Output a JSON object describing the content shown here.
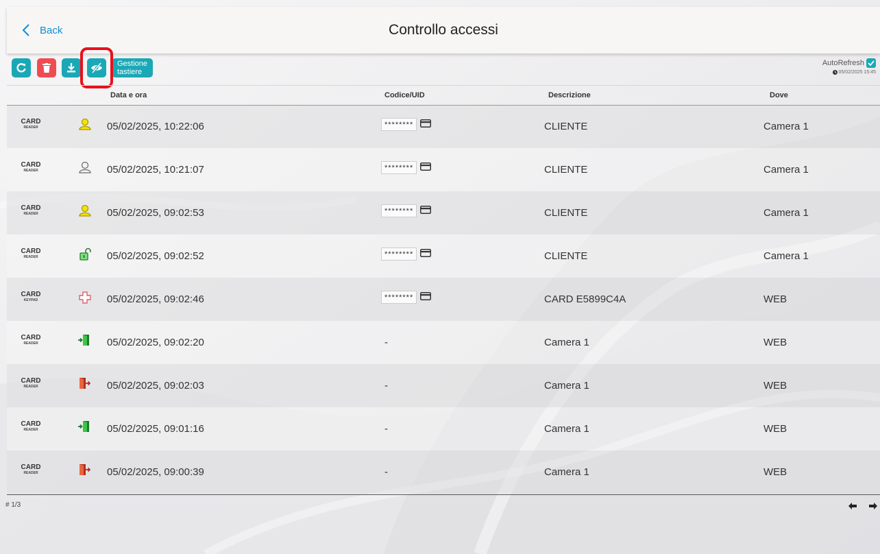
{
  "header": {
    "back_label": "Back",
    "title": "Controllo accessi"
  },
  "toolbar": {
    "buttons": [
      {
        "name": "refresh",
        "icon": "refresh-icon"
      },
      {
        "name": "delete",
        "icon": "trash-icon"
      },
      {
        "name": "download",
        "icon": "download-icon"
      },
      {
        "name": "hide",
        "icon": "eye-slash-icon",
        "highlighted": true
      }
    ],
    "gestione_label": "Gestione tastiere"
  },
  "autorefresh": {
    "label": "AutoRefresh",
    "checked": true,
    "timestamp": "05/02/2025 15:45"
  },
  "table": {
    "columns": {
      "date": "Data e ora",
      "code": "Codice/UID",
      "desc": "Descrizione",
      "dove": "Dove"
    },
    "rows": [
      {
        "src_a": "CARD",
        "src_b": "READER",
        "icon": "user-yellow-icon",
        "date": "05/02/2025, 10:22:06",
        "code": "********",
        "desc": "CLIENTE",
        "dove": "Camera 1"
      },
      {
        "src_a": "CARD",
        "src_b": "READER",
        "icon": "user-outline-icon",
        "date": "05/02/2025, 10:21:07",
        "code": "********",
        "desc": "CLIENTE",
        "dove": "Camera 1"
      },
      {
        "src_a": "CARD",
        "src_b": "READER",
        "icon": "user-yellow-icon",
        "date": "05/02/2025, 09:02:53",
        "code": "********",
        "desc": "CLIENTE",
        "dove": "Camera 1"
      },
      {
        "src_a": "CARD",
        "src_b": "READER",
        "icon": "unlock-icon",
        "date": "05/02/2025, 09:02:52",
        "code": "********",
        "desc": "CLIENTE",
        "dove": "Camera 1"
      },
      {
        "src_a": "CARD",
        "src_b": "KEYPAD",
        "icon": "add-cross-icon",
        "date": "05/02/2025, 09:02:46",
        "code": "********",
        "desc": "CARD E5899C4A",
        "dove": "WEB"
      },
      {
        "src_a": "CARD",
        "src_b": "READER",
        "icon": "door-enter-icon",
        "date": "05/02/2025, 09:02:20",
        "code": "-",
        "desc": "Camera 1",
        "dove": "WEB"
      },
      {
        "src_a": "CARD",
        "src_b": "READER",
        "icon": "door-exit-icon",
        "date": "05/02/2025, 09:02:03",
        "code": "-",
        "desc": "Camera 1",
        "dove": "WEB"
      },
      {
        "src_a": "CARD",
        "src_b": "READER",
        "icon": "door-enter-icon",
        "date": "05/02/2025, 09:01:16",
        "code": "-",
        "desc": "Camera 1",
        "dove": "WEB"
      },
      {
        "src_a": "CARD",
        "src_b": "READER",
        "icon": "door-exit-icon",
        "date": "05/02/2025, 09:00:39",
        "code": "-",
        "desc": "Camera 1",
        "dove": "WEB"
      }
    ]
  },
  "pager": {
    "text": "# 1/3"
  },
  "colors": {
    "accent": "#1ba8b6",
    "danger": "#ee4c52",
    "link": "#0a8fd6",
    "highlight": "#e8101c"
  }
}
